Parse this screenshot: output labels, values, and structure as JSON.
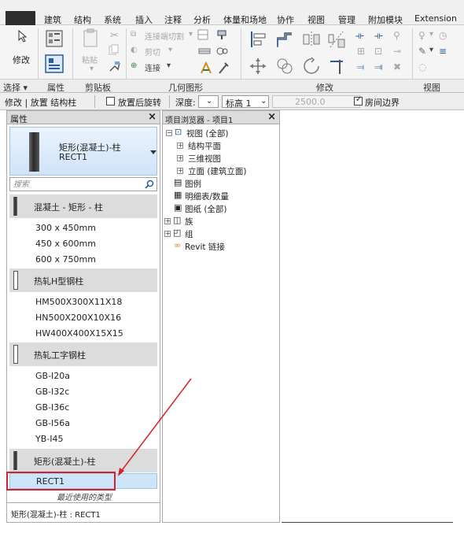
{
  "ribbon": {
    "tabs": [
      "建筑",
      "结构",
      "系统",
      "插入",
      "注释",
      "分析",
      "体量和场地",
      "协作",
      "视图",
      "管理",
      "附加模块",
      "Extension"
    ],
    "panel_labels": {
      "select": "选择 ▾",
      "properties": "属性",
      "clipboard": "剪贴板",
      "geometry": "几何图形",
      "modify": "修改",
      "view": "视图"
    },
    "buttons": {
      "modify": "修改",
      "paste": "粘贴",
      "cope": "连接端切割",
      "cut": "剪切",
      "join": "连接"
    }
  },
  "options_bar": {
    "mode": "修改 | 放置 结构柱",
    "rotate_after_place": "放置后旋转",
    "depth_label": "深度:",
    "level_value": "标高 1",
    "height_value": "2500.0",
    "room_bounding": "房间边界"
  },
  "properties": {
    "title": "属性",
    "selected_family": "矩形(混凝土)-柱",
    "selected_type": "RECT1",
    "search_placeholder": "搜索",
    "groups": [
      {
        "family": "混凝土 - 矩形 - 柱",
        "types": [
          "300 x 450mm",
          "450 x 600mm",
          "600 x 750mm"
        ]
      },
      {
        "family": "热轧H型钢柱",
        "types": [
          "HM500X300X11X18",
          "HN500X200X10X16",
          "HW400X400X15X15"
        ]
      },
      {
        "family": "热轧工字钢柱",
        "types": [
          "GB-I20a",
          "GB-I32c",
          "GB-I36c",
          "GB-I56a",
          "YB-I45"
        ]
      },
      {
        "family": "矩形(混凝土)-柱",
        "types": [
          "RECT1"
        ]
      }
    ],
    "recent_label": "最近使用的类型",
    "footer": "矩形(混凝土)-柱 : RECT1"
  },
  "browser": {
    "title": "项目浏览器 - 项目1",
    "tree": {
      "views_all": "视图 (全部)",
      "structural_plans": "结构平面",
      "three_d_views": "三维视图",
      "elevations": "立面 (建筑立面)",
      "legends": "图例",
      "schedules": "明细表/数量",
      "sheets": "图纸 (全部)",
      "families": "族",
      "groups": "组",
      "revit_links": "Revit 链接"
    }
  },
  "colors": {
    "selection_fill": "#cde5f8",
    "annotation_red": "#d8202c",
    "header_grey": "#dcdcdc"
  }
}
